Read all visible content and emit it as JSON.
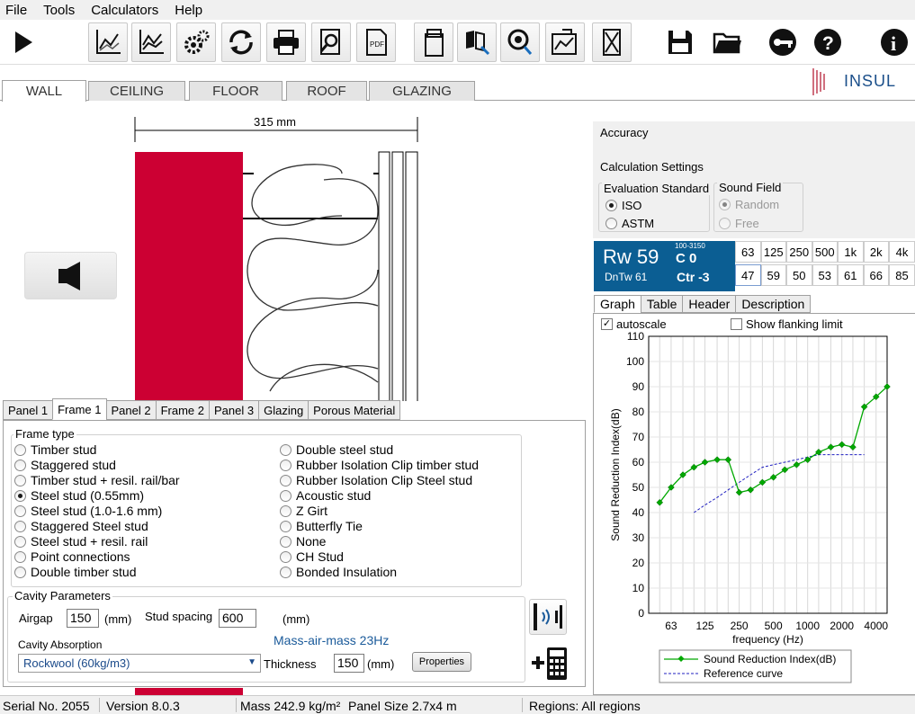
{
  "menu": [
    "File",
    "Tools",
    "Calculators",
    "Help"
  ],
  "toolbar": [
    "play-icon",
    "graph-icon",
    "graph-compare-icon",
    "settings-icon",
    "refresh-icon",
    "print-icon",
    "print-preview-icon",
    "pdf-icon",
    "copy-icon",
    "export-icon",
    "sound-icon",
    "chart-export-icon",
    "clear-icon",
    "save-icon",
    "open-folder-icon",
    "key-icon",
    "help-icon",
    "info-icon"
  ],
  "main_tabs": [
    "WALL",
    "CEILING",
    "FLOOR",
    "ROOF",
    "GLAZING"
  ],
  "logo_text": "INSUL",
  "dimension": "315 mm",
  "panel_tabs": [
    "Panel 1",
    "Frame 1",
    "Panel 2",
    "Frame 2",
    "Panel 3",
    "Glazing",
    "Porous Material"
  ],
  "frame_type": {
    "title": "Frame type",
    "left": [
      "Timber stud",
      "Staggered stud",
      "Timber stud + resil. rail/bar",
      "Steel stud (0.55mm)",
      "Steel stud (1.0-1.6 mm)",
      "Staggered Steel stud",
      "Steel stud + resil. rail",
      "Point connections",
      "Double timber stud"
    ],
    "right": [
      "Double steel stud",
      "Rubber Isolation Clip timber stud",
      "Rubber Isolation Clip Steel stud",
      "Acoustic stud",
      "Z Girt",
      "Butterfly Tie",
      "None",
      "CH Stud",
      "Bonded Insulation"
    ],
    "selected": "Steel stud (0.55mm)"
  },
  "cavity": {
    "title": "Cavity Parameters",
    "airgap_label": "Airgap",
    "airgap_value": "150",
    "airgap_unit": "(mm)",
    "stud_label": "Stud spacing",
    "stud_value": "600",
    "stud_unit": "(mm)",
    "mam": "Mass-air-mass 23Hz",
    "absorption_label": "Cavity Absorption",
    "absorption_value": "Rockwool (60kg/m3)",
    "thickness_label": "Thickness",
    "thickness_value": "150",
    "thickness_unit": "(mm)",
    "properties_button": "Properties"
  },
  "status": {
    "serial": "Serial No. 2055",
    "version": "Version  8.0.3",
    "mass": "Mass 242.9 kg/m²",
    "panel_size": "Panel Size 2.7x4 m",
    "regions": "Regions: All regions"
  },
  "right": {
    "accuracy": "Accuracy",
    "calc_settings": "Calculation Settings",
    "eval_standard": "Evaluation Standard",
    "iso": "ISO",
    "astm": "ASTM",
    "sound_field": "Sound Field",
    "random": "Random",
    "free": "Free"
  },
  "rating": {
    "rw": "Rw 59",
    "dntw": "DnTw 61",
    "range": "100-3150",
    "c": "C 0",
    "ctr": "Ctr -3"
  },
  "octave": {
    "freqs": [
      "63",
      "125",
      "250",
      "500",
      "1k",
      "2k",
      "4k"
    ],
    "values": [
      "47",
      "59",
      "50",
      "53",
      "61",
      "66",
      "85"
    ]
  },
  "graph_tabs": [
    "Graph",
    "Table",
    "Header",
    "Description"
  ],
  "autoscale": "autoscale",
  "flanking": "Show flanking limit",
  "colors": {
    "wall_red": "#cc0033",
    "rw_blue": "#0b5e93",
    "series_green": "#00a800",
    "reference_blue": "#2020c0"
  },
  "chart_data": {
    "type": "line",
    "xlabel": "frequency (Hz)",
    "ylabel": "Sound Reduction Index(dB)",
    "ylim": [
      0,
      110
    ],
    "yticks": [
      0,
      10,
      20,
      30,
      40,
      50,
      60,
      70,
      80,
      90,
      100,
      110
    ],
    "xticks": [
      "63",
      "125",
      "250",
      "500",
      "1000",
      "2000",
      "4000"
    ],
    "x_scale": "log",
    "xlim": [
      40,
      5000
    ],
    "series": [
      {
        "name": "Sound Reduction Index(dB)",
        "x": [
          50,
          63,
          80,
          100,
          125,
          160,
          200,
          250,
          315,
          400,
          500,
          630,
          800,
          1000,
          1250,
          1600,
          2000,
          2500,
          3150,
          4000,
          5000
        ],
        "y": [
          44,
          50,
          55,
          58,
          60,
          61,
          61,
          48,
          49,
          52,
          54,
          57,
          59,
          61,
          64,
          66,
          67,
          66,
          82,
          86,
          90
        ]
      },
      {
        "name": "Reference curve",
        "x": [
          100,
          125,
          160,
          200,
          250,
          315,
          400,
          500,
          630,
          800,
          1000,
          1250,
          1600,
          2000,
          2500,
          3150
        ],
        "y": [
          40,
          43,
          46,
          49,
          52,
          55,
          58,
          59,
          60,
          61,
          62,
          63,
          63,
          63,
          63,
          63
        ]
      }
    ],
    "legend": "bottom"
  }
}
